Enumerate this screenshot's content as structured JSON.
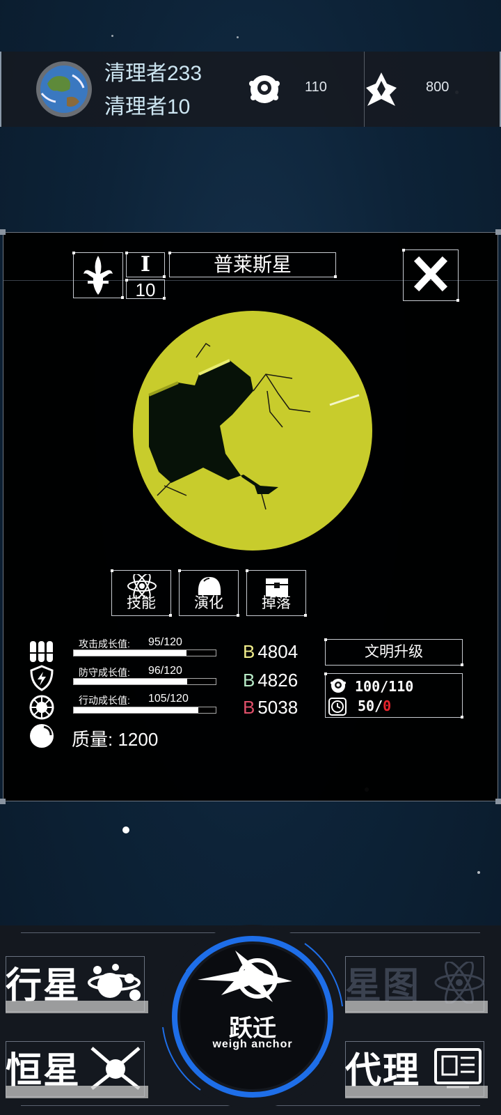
{
  "top_bar": {
    "player_name": "清理者233",
    "player_sub": "清理者10",
    "resources": [
      {
        "icon": "eye-orb-icon",
        "value": "110"
      },
      {
        "icon": "crystal-emblem-icon",
        "value": "800"
      }
    ]
  },
  "planet_panel": {
    "name": "普莱斯星",
    "tier": "I",
    "level": "10",
    "emblem": "fleur-de-lis-icon",
    "planet_color": "#c8cc2c",
    "tabs": [
      {
        "label": "技能",
        "icon": "atom-icon"
      },
      {
        "label": "演化",
        "icon": "dome-icon"
      },
      {
        "label": "掉落",
        "icon": "chest-icon"
      }
    ],
    "stats": [
      {
        "label": "攻击成长值:",
        "value": "95/120",
        "ratio": 0.792,
        "icon": "bullets-icon"
      },
      {
        "label": "防守成长值:",
        "value": "96/120",
        "ratio": 0.8,
        "icon": "shield-bolt-icon"
      },
      {
        "label": "行动成长值:",
        "value": "105/120",
        "ratio": 0.875,
        "icon": "wheel-icon"
      }
    ],
    "mass": "质量: 1200",
    "b_values": [
      {
        "letter": "B",
        "value": "4804",
        "color": "#f2ef8c"
      },
      {
        "letter": "B",
        "value": "4826",
        "color": "#b8ecc8"
      },
      {
        "letter": "B",
        "value": "5038",
        "color": "#e0506a"
      }
    ],
    "upgrade_label": "文明升级",
    "cost": {
      "line1": "100/110",
      "line2_a": "50/",
      "line2_b": "0",
      "line2_b_color": "#e8242c"
    }
  },
  "bottom_nav": {
    "left": [
      {
        "label": "行星",
        "icon": "planet-system-icon"
      },
      {
        "label": "恒星",
        "icon": "star-ship-icon"
      }
    ],
    "right": [
      {
        "label": "星图",
        "icon": "atom-icon"
      },
      {
        "label": "代理",
        "icon": "window-icon"
      }
    ],
    "warp_title": "跃迁",
    "warp_sub": "weigh anchor",
    "accent": "#1e6ee8"
  }
}
